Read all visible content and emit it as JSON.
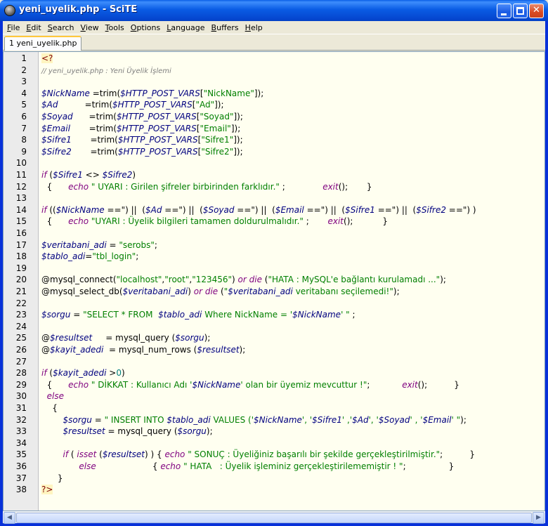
{
  "window": {
    "title": "yeni_uyelik.php - SciTE"
  },
  "menubar": {
    "items": [
      {
        "key": "F",
        "rest": "ile"
      },
      {
        "key": "E",
        "rest": "dit"
      },
      {
        "key": "S",
        "rest": "earch"
      },
      {
        "key": "V",
        "rest": "iew"
      },
      {
        "key": "T",
        "rest": "ools"
      },
      {
        "key": "O",
        "rest": "ptions"
      },
      {
        "key": "L",
        "rest": "anguage"
      },
      {
        "key": "B",
        "rest": "uffers"
      },
      {
        "key": "H",
        "rest": "elp"
      }
    ]
  },
  "tabs": [
    {
      "label": "1 yeni_uyelik.php",
      "active": true
    }
  ],
  "editor": {
    "lines": [
      [
        [
          "tag",
          "<?"
        ]
      ],
      [
        [
          "cm",
          "// yeni_uyelik.php : Yeni Üyelik İşlemi"
        ]
      ],
      [],
      [
        [
          "var",
          "$NickName"
        ],
        [
          "p",
          " =trim("
        ],
        [
          "var",
          "$HTTP_POST_VARS"
        ],
        [
          "p",
          "["
        ],
        [
          "str",
          "\"NickName\""
        ],
        [
          "p",
          "]);"
        ]
      ],
      [
        [
          "var",
          "$Ad"
        ],
        [
          "p",
          "          =trim("
        ],
        [
          "var",
          "$HTTP_POST_VARS"
        ],
        [
          "p",
          "["
        ],
        [
          "str",
          "\"Ad\""
        ],
        [
          "p",
          "]);"
        ]
      ],
      [
        [
          "var",
          "$Soyad"
        ],
        [
          "p",
          "      =trim("
        ],
        [
          "var",
          "$HTTP_POST_VARS"
        ],
        [
          "p",
          "["
        ],
        [
          "str",
          "\"Soyad\""
        ],
        [
          "p",
          "]);"
        ]
      ],
      [
        [
          "var",
          "$Email"
        ],
        [
          "p",
          "       =trim("
        ],
        [
          "var",
          "$HTTP_POST_VARS"
        ],
        [
          "p",
          "["
        ],
        [
          "str",
          "\"Email\""
        ],
        [
          "p",
          "]);"
        ]
      ],
      [
        [
          "var",
          "$Sifre1"
        ],
        [
          "p",
          "       =trim("
        ],
        [
          "var",
          "$HTTP_POST_VARS"
        ],
        [
          "p",
          "["
        ],
        [
          "str",
          "\"Sifre1\""
        ],
        [
          "p",
          "]);"
        ]
      ],
      [
        [
          "var",
          "$Sifre2"
        ],
        [
          "p",
          "       =trim("
        ],
        [
          "var",
          "$HTTP_POST_VARS"
        ],
        [
          "p",
          "["
        ],
        [
          "str",
          "\"Sifre2\""
        ],
        [
          "p",
          "]);"
        ]
      ],
      [],
      [
        [
          "kw",
          "if"
        ],
        [
          "p",
          " ("
        ],
        [
          "var",
          "$Sifre1"
        ],
        [
          "p",
          " <> "
        ],
        [
          "var",
          "$Sifre2"
        ],
        [
          "p",
          ")"
        ]
      ],
      [
        [
          "p",
          "  {      "
        ],
        [
          "kw",
          "echo"
        ],
        [
          "str",
          " \" UYARI : Girilen şifreler birbirinden farklıdır.\""
        ],
        [
          "p",
          " ;              "
        ],
        [
          "kw",
          "exit"
        ],
        [
          "p",
          "();       }"
        ]
      ],
      [],
      [
        [
          "kw",
          "if"
        ],
        [
          "p",
          " (("
        ],
        [
          "var",
          "$NickName"
        ],
        [
          "p",
          " ==\") ||  ("
        ],
        [
          "var",
          "$Ad"
        ],
        [
          "p",
          " ==\") ||  ("
        ],
        [
          "var",
          "$Soyad"
        ],
        [
          "p",
          " ==\") ||  ("
        ],
        [
          "var",
          "$Email"
        ],
        [
          "p",
          " ==\") ||  ("
        ],
        [
          "var",
          "$Sifre1"
        ],
        [
          "p",
          " ==\") ||  ("
        ],
        [
          "var",
          "$Sifre2"
        ],
        [
          "p",
          " ==\") )"
        ]
      ],
      [
        [
          "p",
          "  {      "
        ],
        [
          "kw",
          "echo"
        ],
        [
          "str",
          " \"UYARI : Üyelik bilgileri tamamen doldurulmalıdır.\""
        ],
        [
          "p",
          " ;       "
        ],
        [
          "kw",
          "exit"
        ],
        [
          "p",
          "();           }"
        ]
      ],
      [],
      [
        [
          "var",
          "$veritabani_adi"
        ],
        [
          "p",
          " = "
        ],
        [
          "str",
          "\"serobs\""
        ],
        [
          "p",
          ";"
        ]
      ],
      [
        [
          "var",
          "$tablo_adi"
        ],
        [
          "p",
          "="
        ],
        [
          "str",
          "\"tbl_login\""
        ],
        [
          "p",
          ";"
        ]
      ],
      [],
      [
        [
          "p",
          "@mysql_connect("
        ],
        [
          "str",
          "\"localhost\""
        ],
        [
          "p",
          ","
        ],
        [
          "str",
          "\"root\""
        ],
        [
          "p",
          ","
        ],
        [
          "str",
          "\"123456\""
        ],
        [
          "p",
          ") "
        ],
        [
          "kw",
          "or die"
        ],
        [
          "p",
          " ("
        ],
        [
          "str",
          "\"HATA : MySQL'e bağlantı kurulamadı ...\""
        ],
        [
          "p",
          ");"
        ]
      ],
      [
        [
          "p",
          "@mysql_select_db("
        ],
        [
          "var",
          "$veritabani_adi"
        ],
        [
          "p",
          ") "
        ],
        [
          "kw",
          "or die"
        ],
        [
          "p",
          " ("
        ],
        [
          "str",
          "\""
        ],
        [
          "var",
          "$veritabani_adi"
        ],
        [
          "str",
          " veritabanı seçilemedi!\""
        ],
        [
          "p",
          ");"
        ]
      ],
      [],
      [
        [
          "var",
          "$sorgu"
        ],
        [
          "p",
          " = "
        ],
        [
          "str",
          "\"SELECT * FROM  "
        ],
        [
          "var",
          "$tablo_adi"
        ],
        [
          "str",
          " Where NickName = '"
        ],
        [
          "var",
          "$NickName"
        ],
        [
          "str",
          "' \""
        ],
        [
          "p",
          " ;"
        ]
      ],
      [],
      [
        [
          "p",
          "@"
        ],
        [
          "var",
          "$resultset"
        ],
        [
          "p",
          "     = mysql_query ("
        ],
        [
          "var",
          "$sorgu"
        ],
        [
          "p",
          ");"
        ]
      ],
      [
        [
          "p",
          "@"
        ],
        [
          "var",
          "$kayit_adedi"
        ],
        [
          "p",
          "  = mysql_num_rows ("
        ],
        [
          "var",
          "$resultset"
        ],
        [
          "p",
          ");"
        ]
      ],
      [],
      [
        [
          "kw",
          "if"
        ],
        [
          "p",
          " ("
        ],
        [
          "var",
          "$kayit_adedi"
        ],
        [
          "p",
          " >"
        ],
        [
          "num",
          "0"
        ],
        [
          "p",
          ")"
        ]
      ],
      [
        [
          "p",
          "  {      "
        ],
        [
          "kw",
          "echo"
        ],
        [
          "str",
          " \" DİKKAT : Kullanıcı Adı '"
        ],
        [
          "var",
          "$NickName"
        ],
        [
          "str",
          "' olan bir üyemiz mevcuttur !\""
        ],
        [
          "p",
          ";            "
        ],
        [
          "kw",
          "exit"
        ],
        [
          "p",
          "();          }"
        ]
      ],
      [
        [
          "p",
          "  "
        ],
        [
          "kw",
          "else"
        ]
      ],
      [
        [
          "p",
          "    {"
        ]
      ],
      [
        [
          "p",
          "        "
        ],
        [
          "var",
          "$sorgu"
        ],
        [
          "p",
          " = "
        ],
        [
          "str",
          "\" INSERT INTO "
        ],
        [
          "var",
          "$tablo_adi"
        ],
        [
          "str",
          " VALUES ('"
        ],
        [
          "var",
          "$NickName"
        ],
        [
          "str",
          "', '"
        ],
        [
          "var",
          "$Sifre1"
        ],
        [
          "str",
          "' ,'"
        ],
        [
          "var",
          "$Ad"
        ],
        [
          "str",
          "', '"
        ],
        [
          "var",
          "$Soyad"
        ],
        [
          "str",
          "' , '"
        ],
        [
          "var",
          "$Email"
        ],
        [
          "str",
          "' \""
        ],
        [
          "p",
          ");"
        ]
      ],
      [
        [
          "p",
          "        "
        ],
        [
          "var",
          "$resultset"
        ],
        [
          "p",
          " = mysql_query ("
        ],
        [
          "var",
          "$sorgu"
        ],
        [
          "p",
          ");"
        ]
      ],
      [],
      [
        [
          "p",
          "        "
        ],
        [
          "kw",
          "if"
        ],
        [
          "p",
          " ( "
        ],
        [
          "kw",
          "isset"
        ],
        [
          "p",
          " ("
        ],
        [
          "var",
          "$resultset"
        ],
        [
          "p",
          ") ) { "
        ],
        [
          "kw",
          "echo"
        ],
        [
          "str",
          " \" SONUÇ : Üyeliğiniz başarılı bir şekilde gerçekleştirilmiştir.\""
        ],
        [
          "p",
          ";          }"
        ]
      ],
      [
        [
          "p",
          "              "
        ],
        [
          "kw",
          "else"
        ],
        [
          "p",
          "                     { "
        ],
        [
          "kw",
          "echo"
        ],
        [
          "str",
          " \" HATA   : Üyelik işleminiz gerçekleştirilememiştir ! \""
        ],
        [
          "p",
          ";                }"
        ]
      ],
      [
        [
          "p",
          "      }"
        ]
      ],
      [
        [
          "tag",
          "?>"
        ]
      ]
    ]
  }
}
